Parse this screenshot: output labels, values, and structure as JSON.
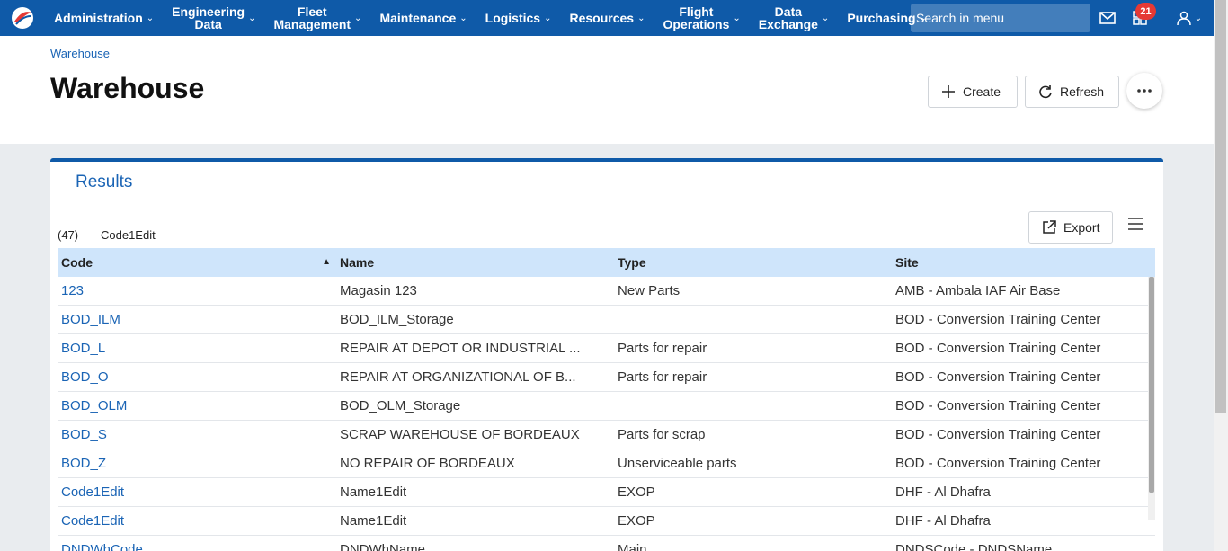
{
  "nav": {
    "items": [
      {
        "label": "Administration"
      },
      {
        "label": "Engineering\nData"
      },
      {
        "label": "Fleet\nManagement"
      },
      {
        "label": "Maintenance"
      },
      {
        "label": "Logistics"
      },
      {
        "label": "Resources"
      },
      {
        "label": "Flight\nOperations"
      },
      {
        "label": "Data\nExchange"
      },
      {
        "label": "Purchasing"
      }
    ],
    "search_placeholder": "Search in menu",
    "notification_count": "21",
    "icons": [
      "logo-icon",
      "mail-icon",
      "dashboard-icon",
      "user-icon"
    ]
  },
  "breadcrumb": "Warehouse",
  "page_title": "Warehouse",
  "actions": {
    "create": "Create",
    "refresh": "Refresh"
  },
  "results": {
    "title": "Results",
    "count": "(47)",
    "filter_value": "Code1Edit",
    "export": "Export",
    "columns": [
      "Code",
      "Name",
      "Type",
      "Site"
    ],
    "rows": [
      [
        "123",
        "Magasin 123",
        "New Parts",
        "AMB - Ambala IAF Air Base"
      ],
      [
        "BOD_ILM",
        "BOD_ILM_Storage",
        "",
        "BOD - Conversion Training Center"
      ],
      [
        "BOD_L",
        "REPAIR AT DEPOT OR INDUSTRIAL ...",
        "Parts for repair",
        "BOD - Conversion Training Center"
      ],
      [
        "BOD_O",
        "REPAIR AT ORGANIZATIONAL OF B...",
        "Parts for repair",
        "BOD - Conversion Training Center"
      ],
      [
        "BOD_OLM",
        "BOD_OLM_Storage",
        "",
        "BOD - Conversion Training Center"
      ],
      [
        "BOD_S",
        "SCRAP WAREHOUSE OF BORDEAUX",
        "Parts for scrap",
        "BOD - Conversion Training Center"
      ],
      [
        "BOD_Z",
        "NO REPAIR OF BORDEAUX",
        "Unserviceable parts",
        "BOD - Conversion Training Center"
      ],
      [
        "Code1Edit",
        "Name1Edit",
        "EXOP",
        "DHF - Al Dhafra"
      ],
      [
        "Code1Edit",
        "Name1Edit",
        "EXOP",
        "DHF - Al Dhafra"
      ],
      [
        "DNDWhCode",
        "DNDWhName",
        "Main",
        "DNDSCode - DNDSName"
      ]
    ]
  }
}
